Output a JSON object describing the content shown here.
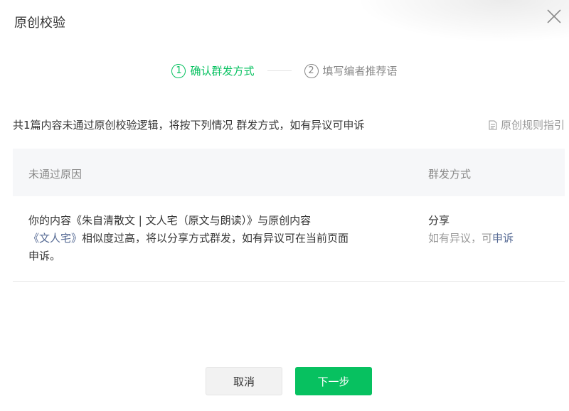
{
  "dialog": {
    "title": "原创校验"
  },
  "steps": [
    {
      "number": "1",
      "label": "确认群发方式",
      "state": "active"
    },
    {
      "number": "2",
      "label": "填写编者推荐语",
      "state": "inactive"
    }
  ],
  "summary": {
    "text": "共1篇内容未通过原创校验逻辑，将按下列情况 群发方式，如有异议可申诉",
    "rules_link": "原创规则指引"
  },
  "table": {
    "headers": {
      "reason": "未通过原因",
      "method": "群发方式"
    },
    "rows": [
      {
        "reason_prefix": "你的内容《朱自清散文 | 文人宅（原文与朗读）》与原创内容",
        "reason_link": "《文人宅》",
        "reason_suffix": "相似度过高，将以分享方式群发，如有异议可在当前页面申诉。",
        "method": "分享",
        "appeal_prefix": "如有异议，可",
        "appeal_link": "申诉"
      }
    ]
  },
  "buttons": {
    "cancel": "取消",
    "next": "下一步"
  },
  "colors": {
    "accent": "#07c160",
    "link": "#576b95",
    "muted": "#888888"
  },
  "icons": {
    "close": "close-icon",
    "rules": "document-icon"
  }
}
